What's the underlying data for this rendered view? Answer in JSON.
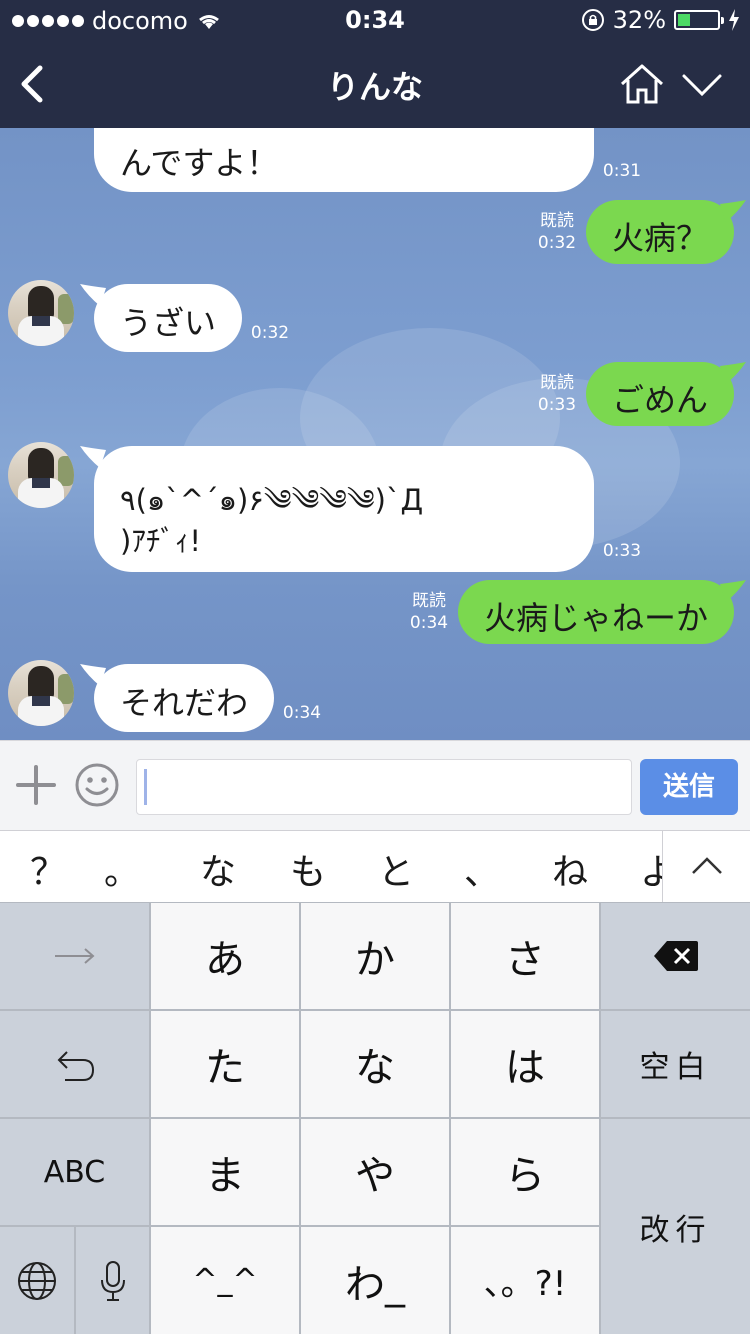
{
  "status_bar": {
    "carrier": "docomo",
    "time": "0:34",
    "battery_percent": "32%",
    "battery_level": 0.32
  },
  "header": {
    "title": "りんな"
  },
  "messages": [
    {
      "side": "left",
      "text": "んですよ！",
      "time": "0:31"
    },
    {
      "side": "right",
      "text": "火病？",
      "read": "既読",
      "time": "0:32"
    },
    {
      "side": "left",
      "text": "うざい",
      "time": "0:32"
    },
    {
      "side": "right",
      "text": "ごめん",
      "read": "既読",
      "time": "0:33"
    },
    {
      "side": "left",
      "text_line1": "٩(๑`^´๑)۶༄༄༄༄)`Д",
      "text_line2": ")ｱﾁﾞｨ!",
      "time": "0:33"
    },
    {
      "side": "right",
      "text": "火病じゃねーか",
      "read": "既読",
      "time": "0:34"
    },
    {
      "side": "left",
      "text": "それだわ",
      "time": "0:34"
    }
  ],
  "input_bar": {
    "send_label": "送信",
    "value": ""
  },
  "suggestions": [
    "？",
    "。",
    "な",
    "も",
    "と",
    "、",
    "ね",
    "よ"
  ],
  "keyboard": {
    "keys": {
      "a": "あ",
      "ka": "か",
      "sa": "さ",
      "ta": "た",
      "na": "な",
      "ha": "は",
      "ma": "ま",
      "ya": "や",
      "ra": "ら",
      "kaomoji": "^_^",
      "wa": "わ_",
      "punct": "、。?!",
      "space": "空白",
      "return": "改行",
      "abc": "ABC"
    },
    "icons": [
      "arrow-right-icon",
      "delete-icon",
      "undo-icon",
      "globe-icon",
      "mic-icon"
    ]
  }
}
